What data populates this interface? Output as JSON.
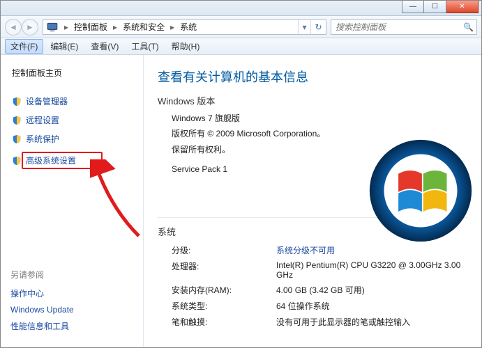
{
  "titlebar": {
    "minimize_glyph": "—",
    "maximize_glyph": "☐",
    "close_glyph": "✕"
  },
  "breadcrumb": {
    "root_glyph": "▸",
    "items": [
      "控制面板",
      "系统和安全",
      "系统"
    ],
    "dropdown_glyph": "▾",
    "refresh_glyph": "↻"
  },
  "search": {
    "placeholder": "搜索控制面板",
    "icon_glyph": "🔍"
  },
  "menu": {
    "file": "文件(F)",
    "edit": "编辑(E)",
    "view": "查看(V)",
    "tools": "工具(T)",
    "help": "帮助(H)"
  },
  "sidebar": {
    "home": "控制面板主页",
    "items": [
      "设备管理器",
      "远程设置",
      "系统保护",
      "高级系统设置"
    ],
    "seealso_title": "另请参阅",
    "seealso_links": [
      "操作中心",
      "Windows Update",
      "性能信息和工具"
    ]
  },
  "main": {
    "title": "查看有关计算机的基本信息",
    "edition_head": "Windows 版本",
    "edition_name": "Windows 7 旗舰版",
    "copyright_line1": "版权所有 © 2009 Microsoft Corporation。",
    "copyright_line2": "保留所有权利。",
    "service_pack": "Service Pack 1",
    "system_head": "系统",
    "specs": [
      {
        "label": "分级:",
        "value": "系统分级不可用",
        "link": true
      },
      {
        "label": "处理器:",
        "value": "Intel(R) Pentium(R) CPU G3220 @ 3.00GHz 3.00 GHz",
        "link": false
      },
      {
        "label": "安装内存(RAM):",
        "value": "4.00 GB (3.42 GB 可用)",
        "link": false
      },
      {
        "label": "系统类型:",
        "value": "64 位操作系统",
        "link": false
      },
      {
        "label": "笔和触摸:",
        "value": "没有可用于此显示器的笔或触控输入",
        "link": false
      }
    ]
  }
}
